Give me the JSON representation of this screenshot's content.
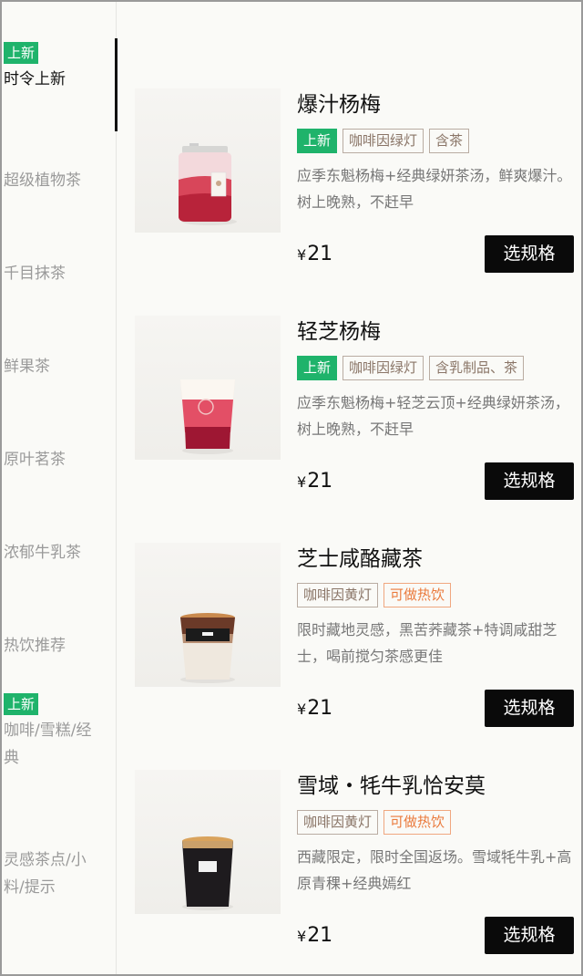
{
  "sidebar": {
    "categories": [
      {
        "badge": "上新",
        "label": "时令上新"
      },
      {
        "badge": "",
        "label": "超级植物茶"
      },
      {
        "badge": "",
        "label": "千目抹茶"
      },
      {
        "badge": "",
        "label": "鲜果茶"
      },
      {
        "badge": "",
        "label": "原叶茗茶"
      },
      {
        "badge": "",
        "label": "浓郁牛乳茶"
      },
      {
        "badge": "",
        "label": "热饮推荐"
      },
      {
        "badge": "上新",
        "label": "咖啡/雪糕/经典"
      },
      {
        "badge": "",
        "label": "灵感茶点/小料/提示"
      }
    ],
    "active_index": 0
  },
  "products": [
    {
      "name": "爆汁杨梅",
      "tags": [
        {
          "text": "上新",
          "type": "new"
        },
        {
          "text": "咖啡因绿灯",
          "type": "plain"
        },
        {
          "text": "含茶",
          "type": "plain"
        }
      ],
      "description": "应季东魁杨梅+经典绿妍茶汤，鲜爽爆汁。树上晚熟，不赶早",
      "currency": "¥",
      "price": "21",
      "button": "选规格",
      "image_icon": "bottle-drink-icon"
    },
    {
      "name": "轻芝杨梅",
      "tags": [
        {
          "text": "上新",
          "type": "new"
        },
        {
          "text": "咖啡因绿灯",
          "type": "plain"
        },
        {
          "text": "含乳制品、茶",
          "type": "plain"
        }
      ],
      "description": "应季东魁杨梅+轻芝云顶+经典绿妍茶汤，树上晚熟，不赶早",
      "currency": "¥",
      "price": "21",
      "button": "选规格",
      "image_icon": "cup-drink-icon"
    },
    {
      "name": "芝士咸酪藏茶",
      "tags": [
        {
          "text": "咖啡因黄灯",
          "type": "plain"
        },
        {
          "text": "可做热饮",
          "type": "hot"
        }
      ],
      "description": "限时藏地灵感，黑苦荞藏茶+特调咸甜芝士，喝前搅匀茶感更佳",
      "currency": "¥",
      "price": "21",
      "button": "选规格",
      "image_icon": "cup-drink-icon"
    },
    {
      "name": "雪域・牦牛乳恰安莫",
      "tags": [
        {
          "text": "咖啡因黄灯",
          "type": "plain"
        },
        {
          "text": "可做热饮",
          "type": "hot"
        }
      ],
      "description": "西藏限定，限时全国返场。雪域牦牛乳+高原青稞+经典嫣红",
      "currency": "¥",
      "price": "21",
      "button": "选规格",
      "image_icon": "cup-drink-icon"
    }
  ],
  "colors": {
    "new_badge": "#1fb36b",
    "hot_tag": "#ea7a3c",
    "button_bg": "#0a0a0a"
  }
}
